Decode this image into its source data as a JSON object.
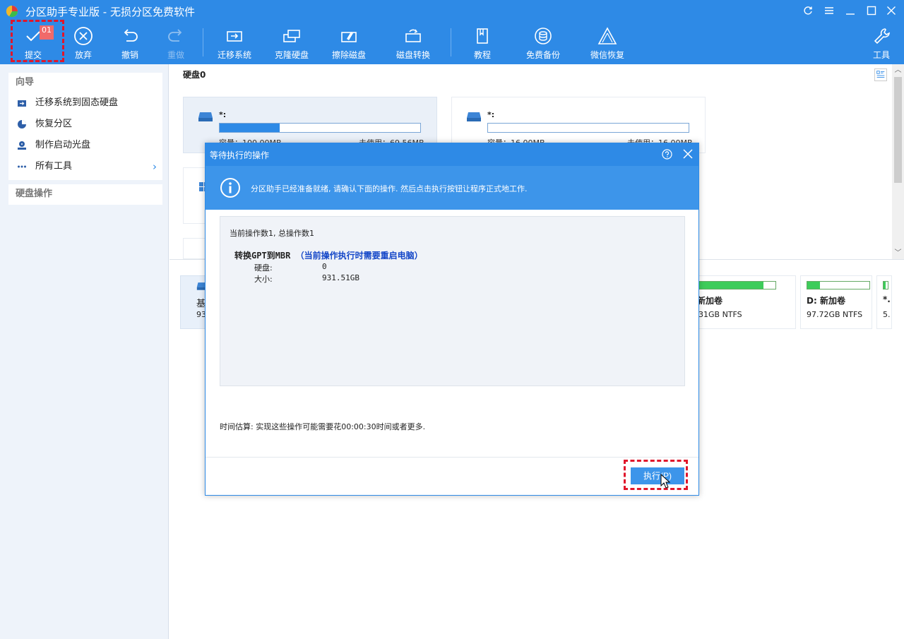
{
  "app": {
    "title": "分区助手专业版 - 无损分区免费软件"
  },
  "window_controls": [
    "refresh-icon",
    "menu-icon",
    "minimize-icon",
    "maximize-icon",
    "close-icon"
  ],
  "toolbar": {
    "submit": {
      "label": "提交",
      "badge": "01"
    },
    "discard": {
      "label": "放弃"
    },
    "undo": {
      "label": "撤销"
    },
    "redo": {
      "label": "重做"
    },
    "migrate": {
      "label": "迁移系统"
    },
    "clone": {
      "label": "克隆硬盘"
    },
    "wipe": {
      "label": "擦除磁盘"
    },
    "convert": {
      "label": "磁盘转换"
    },
    "tutorial": {
      "label": "教程"
    },
    "backup": {
      "label": "免费备份"
    },
    "wechat": {
      "label": "微信恢复"
    },
    "tools": {
      "label": "工具"
    }
  },
  "sidebar": {
    "wizard_header": "向导",
    "items": [
      {
        "label": "迁移系统到固态硬盘",
        "icon": "migrate-icon"
      },
      {
        "label": "恢复分区",
        "icon": "pie-icon"
      },
      {
        "label": "制作启动光盘",
        "icon": "boot-disk-icon"
      },
      {
        "label": "所有工具",
        "icon": "more-icon"
      }
    ],
    "disk_ops_header": "硬盘操作"
  },
  "main": {
    "disk_title": "硬盘0",
    "partitions": [
      {
        "name": "*:",
        "capacity": "容量：100.00MB",
        "unused": "未使用：69.56MB",
        "used_fraction": 0.3
      },
      {
        "name": "*:",
        "capacity": "容量：16.00MB",
        "unused": "未使用：16.00MB",
        "used_fraction": 0.0
      }
    ],
    "lower_left": {
      "name": "基",
      "size": "93"
    },
    "lower_cards": [
      {
        "name": "新加卷",
        "size": "31GB NTFS",
        "used_fraction": 0.85
      },
      {
        "name": "D: 新加卷",
        "size": "97.72GB NTFS",
        "used_fraction": 0.2
      },
      {
        "name": "*.",
        "size": "5.",
        "used_fraction": 0.5
      }
    ]
  },
  "dialog": {
    "title": "等待执行的操作",
    "info": "分区助手已经准备就绪, 请确认下面的操作. 然后点击执行按钮让程序正式地工作.",
    "counter": "当前操作数1, 总操作数1",
    "op_title": "转换GPT到MBR",
    "op_note": "（当前操作执行时需要重启电脑）",
    "op_rows": [
      {
        "label": "硬盘:",
        "value": "0"
      },
      {
        "label": "大小:",
        "value": "931.51GB"
      }
    ],
    "estimate": "时间估算: 实现这些操作可能需要花00:00:30时间或者更多.",
    "execute_label": "执行(P)"
  },
  "colors": {
    "accent": "#2e8ae6",
    "info_bar": "#3d95ea",
    "highlight": "#e0162b",
    "volume_fill": "#3dcc5a",
    "op_note": "#1447c8"
  }
}
